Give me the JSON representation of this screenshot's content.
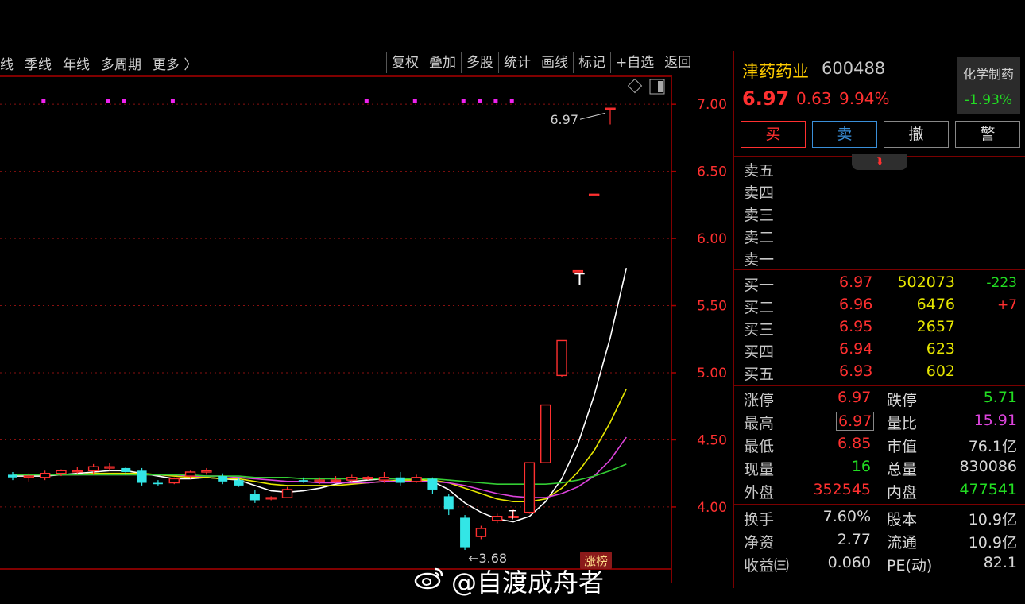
{
  "toolbar": {
    "left_items": [
      "线",
      "季线",
      "年线",
      "多周期",
      "更多 〉"
    ],
    "right_items": [
      "复权",
      "叠加",
      "多股",
      "统计",
      "画线",
      "标记",
      "+自选",
      "返回"
    ]
  },
  "chart_data": {
    "type": "candlestick",
    "y_axis_ticks": [
      "7.00",
      "6.50",
      "6.00",
      "5.50",
      "5.00",
      "4.50",
      "4.00"
    ],
    "ylim": [
      3.52,
      7.22
    ],
    "annotations": {
      "high_label": "6.97",
      "low_label": "3.68",
      "badge": "涨榜",
      "t_markers": [
        "T",
        "T"
      ]
    },
    "candles": [
      {
        "o": 4.24,
        "h": 4.26,
        "l": 4.2,
        "c": 4.22
      },
      {
        "o": 4.22,
        "h": 4.25,
        "l": 4.19,
        "c": 4.23
      },
      {
        "o": 4.22,
        "h": 4.27,
        "l": 4.2,
        "c": 4.25
      },
      {
        "o": 4.25,
        "h": 4.28,
        "l": 4.23,
        "c": 4.27
      },
      {
        "o": 4.27,
        "h": 4.3,
        "l": 4.25,
        "c": 4.27
      },
      {
        "o": 4.27,
        "h": 4.32,
        "l": 4.24,
        "c": 4.3
      },
      {
        "o": 4.29,
        "h": 4.33,
        "l": 4.27,
        "c": 4.3
      },
      {
        "o": 4.29,
        "h": 4.3,
        "l": 4.24,
        "c": 4.26
      },
      {
        "o": 4.27,
        "h": 4.29,
        "l": 4.16,
        "c": 4.18
      },
      {
        "o": 4.18,
        "h": 4.2,
        "l": 4.16,
        "c": 4.17
      },
      {
        "o": 4.18,
        "h": 4.22,
        "l": 4.17,
        "c": 4.21
      },
      {
        "o": 4.23,
        "h": 4.27,
        "l": 4.21,
        "c": 4.26
      },
      {
        "o": 4.26,
        "h": 4.29,
        "l": 4.24,
        "c": 4.27
      },
      {
        "o": 4.23,
        "h": 4.25,
        "l": 4.17,
        "c": 4.19
      },
      {
        "o": 4.2,
        "h": 4.22,
        "l": 4.15,
        "c": 4.16
      },
      {
        "o": 4.1,
        "h": 4.13,
        "l": 4.03,
        "c": 4.05
      },
      {
        "o": 4.06,
        "h": 4.08,
        "l": 4.05,
        "c": 4.07
      },
      {
        "o": 4.07,
        "h": 4.15,
        "l": 4.07,
        "c": 4.13
      },
      {
        "o": 4.2,
        "h": 4.22,
        "l": 4.18,
        "c": 4.19
      },
      {
        "o": 4.19,
        "h": 4.22,
        "l": 4.17,
        "c": 4.2
      },
      {
        "o": 4.2,
        "h": 4.23,
        "l": 4.18,
        "c": 4.2
      },
      {
        "o": 4.2,
        "h": 4.24,
        "l": 4.19,
        "c": 4.22
      },
      {
        "o": 4.21,
        "h": 4.23,
        "l": 4.2,
        "c": 4.22
      },
      {
        "o": 4.2,
        "h": 4.26,
        "l": 4.18,
        "c": 4.22
      },
      {
        "o": 4.22,
        "h": 4.26,
        "l": 4.16,
        "c": 4.18
      },
      {
        "o": 4.19,
        "h": 4.24,
        "l": 4.18,
        "c": 4.22
      },
      {
        "o": 4.21,
        "h": 4.22,
        "l": 4.1,
        "c": 4.13
      },
      {
        "o": 4.08,
        "h": 4.1,
        "l": 3.94,
        "c": 3.98
      },
      {
        "o": 3.92,
        "h": 3.94,
        "l": 3.68,
        "c": 3.7
      },
      {
        "o": 3.78,
        "h": 3.86,
        "l": 3.76,
        "c": 3.84
      },
      {
        "o": 3.9,
        "h": 3.95,
        "l": 3.88,
        "c": 3.93
      },
      {
        "o": 3.93,
        "h": 3.98,
        "l": 3.93,
        "c": 3.93
      },
      {
        "o": 3.96,
        "h": 4.33,
        "l": 3.95,
        "c": 4.33
      },
      {
        "o": 4.33,
        "h": 4.76,
        "l": 4.33,
        "c": 4.76
      },
      {
        "o": 4.98,
        "h": 5.24,
        "l": 4.97,
        "c": 5.24
      },
      {
        "o": 5.76,
        "h": 5.76,
        "l": 5.76,
        "c": 5.76
      },
      {
        "o": 6.33,
        "h": 6.33,
        "l": 6.33,
        "c": 6.33
      },
      {
        "o": 6.97,
        "h": 6.97,
        "l": 6.85,
        "c": 6.97
      }
    ],
    "series": [
      {
        "name": "",
        "color": "#ffffff",
        "values": [
          4.23,
          4.23,
          4.23,
          4.24,
          4.25,
          4.26,
          4.27,
          4.27,
          4.25,
          4.23,
          4.21,
          4.21,
          4.22,
          4.21,
          4.2,
          4.16,
          4.12,
          4.11,
          4.12,
          4.14,
          4.17,
          4.19,
          4.2,
          4.21,
          4.21,
          4.21,
          4.19,
          4.13,
          4.03,
          3.96,
          3.91,
          3.89,
          3.93,
          4.04,
          4.21,
          4.47,
          4.83,
          5.26,
          5.78
        ]
      },
      {
        "name": "",
        "color": "#e6e600",
        "values": [
          4.24,
          4.24,
          4.24,
          4.24,
          4.24,
          4.25,
          4.25,
          4.25,
          4.25,
          4.24,
          4.23,
          4.22,
          4.22,
          4.21,
          4.21,
          4.19,
          4.17,
          4.16,
          4.16,
          4.16,
          4.16,
          4.17,
          4.18,
          4.19,
          4.2,
          4.2,
          4.2,
          4.18,
          4.14,
          4.1,
          4.06,
          4.04,
          4.04,
          4.06,
          4.14,
          4.26,
          4.42,
          4.63,
          4.88
        ]
      },
      {
        "name": "",
        "color": "#dd44dd",
        "values": [
          4.24,
          4.24,
          4.24,
          4.24,
          4.24,
          4.24,
          4.24,
          4.24,
          4.24,
          4.24,
          4.24,
          4.23,
          4.23,
          4.23,
          4.22,
          4.21,
          4.2,
          4.19,
          4.19,
          4.18,
          4.18,
          4.18,
          4.18,
          4.19,
          4.19,
          4.19,
          4.19,
          4.18,
          4.16,
          4.13,
          4.1,
          4.08,
          4.07,
          4.07,
          4.1,
          4.15,
          4.23,
          4.35,
          4.52
        ]
      },
      {
        "name": "",
        "color": "#33cc33",
        "values": [
          4.24,
          4.24,
          4.24,
          4.24,
          4.24,
          4.24,
          4.24,
          4.24,
          4.24,
          4.24,
          4.24,
          4.24,
          4.23,
          4.23,
          4.23,
          4.22,
          4.22,
          4.22,
          4.21,
          4.21,
          4.21,
          4.21,
          4.21,
          4.21,
          4.21,
          4.21,
          4.21,
          4.2,
          4.19,
          4.18,
          4.17,
          4.17,
          4.17,
          4.17,
          4.18,
          4.2,
          4.23,
          4.27,
          4.32
        ]
      }
    ],
    "markers": [
      1,
      5,
      6,
      9,
      21,
      24,
      27,
      28,
      29,
      30
    ]
  },
  "stock": {
    "name": "津药药业",
    "code": "600488",
    "sector_name": "化学制药",
    "sector_pct": "-1.93%",
    "price": "6.97",
    "change": "0.63",
    "change_pct": "9.94%"
  },
  "trade_buttons": {
    "buy": "买",
    "sell": "卖",
    "cancel": "撤",
    "alert": "警"
  },
  "sell_book": [
    "卖五",
    "卖四",
    "卖三",
    "卖二",
    "卖一"
  ],
  "buy_book": [
    {
      "label": "买一",
      "price": "6.97",
      "vol": "502073",
      "delta": "-223"
    },
    {
      "label": "买二",
      "price": "6.96",
      "vol": "6476",
      "delta": "+7"
    },
    {
      "label": "买三",
      "price": "6.95",
      "vol": "2657",
      "delta": ""
    },
    {
      "label": "买四",
      "price": "6.94",
      "vol": "623",
      "delta": ""
    },
    {
      "label": "买五",
      "price": "6.93",
      "vol": "602",
      "delta": ""
    }
  ],
  "stats": {
    "limit_up_label": "涨停",
    "limit_up": "6.97",
    "limit_down_label": "跌停",
    "limit_down": "5.71",
    "high_label": "最高",
    "high": "6.97",
    "vol_ratio_label": "量比",
    "vol_ratio": "15.91",
    "low_label": "最低",
    "low": "6.85",
    "mcap_label": "市值",
    "mcap": "76.1亿",
    "cur_vol_label": "现量",
    "cur_vol": "16",
    "total_vol_label": "总量",
    "total_vol": "830086",
    "outer_label": "外盘",
    "outer": "352545",
    "inner_label": "内盘",
    "inner": "477541"
  },
  "fundamentals": {
    "turnover_label": "换手",
    "turnover": "7.60%",
    "capital_label": "股本",
    "capital": "10.9亿",
    "nav_label": "净资",
    "nav": "2.77",
    "float_label": "流通",
    "float": "10.9亿",
    "eps_label": "收益㈢",
    "eps": "0.060",
    "pe_label": "PE(动)",
    "pe": "82.1"
  },
  "watermark": "@自渡成舟者"
}
